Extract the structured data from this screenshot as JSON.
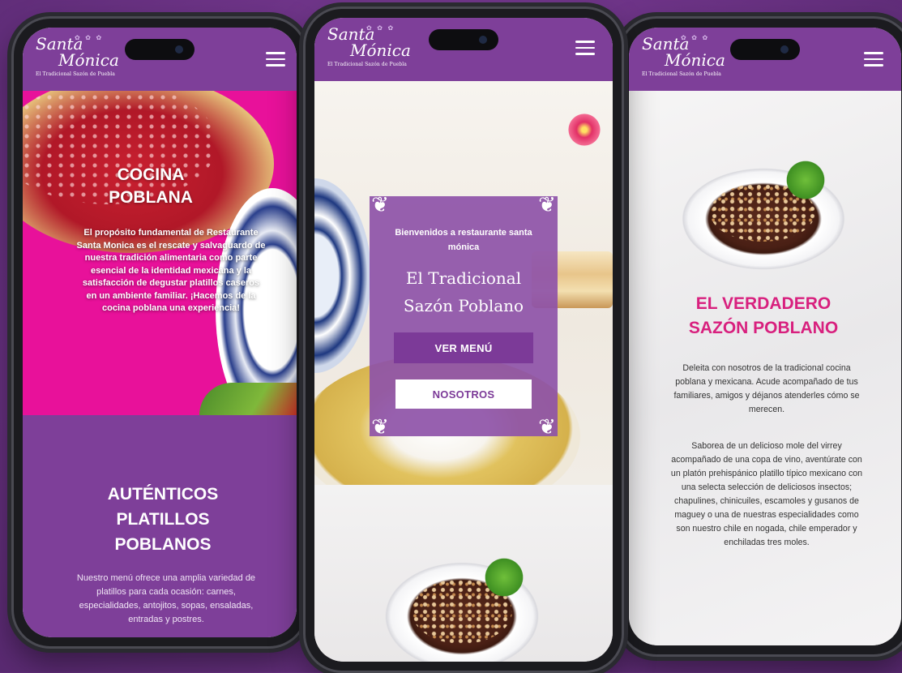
{
  "brand": {
    "logo_line1": "Santa",
    "logo_line2": "Mónica",
    "logo_tagline": "El Tradicional Sazón de Puebla",
    "accent_purple": "#7e3f99",
    "accent_pink": "#d8207e"
  },
  "phone1": {
    "hero_title": "COCINA POBLANA",
    "hero_text": "El propósito fundamental de Restaurante Santa Monica es el rescate y salvaguardo de nuestra tradición alimentaria como parte esencial de la identidad mexicana y la satisfacción de degustar platillos caseros en un ambiente familiar. ¡Hacemos de la cocina poblana una experiencia!",
    "section_title": "AUTÉNTICOS PLATILLOS POBLANOS",
    "section_text": "Nuestro menú ofrece una amplia variedad de platillos para cada ocasión: carnes, especialidades, antojitos, sopas, ensaladas, entradas y postres."
  },
  "phone2": {
    "welcome": "Bienvenidos a restaurante santa mónica",
    "title": "El Tradicional Sazón Poblano",
    "btn_menu": "VER MENÚ",
    "btn_about": "NOSOTROS"
  },
  "phone3": {
    "title": "EL VERDADERO SAZÓN POBLANO",
    "p1": "Deleita con nosotros de la tradicional cocina poblana y mexicana. Acude acompañado de tus familiares, amigos y déjanos atenderles cómo se merecen.",
    "p2": "Saborea de un delicioso mole del virrey acompañado de una copa de vino, aventúrate con un platón prehispánico platillo típico mexicano con una selecta selección de deliciosos insectos; chapulines, chinicuiles, escamoles y gusanos de maguey o una de nuestras especialidades como son nuestro chile en nogada, chile emperador y enchiladas tres moles."
  },
  "icons": {
    "menu": "hamburger-icon",
    "corner": "ornament-corner-icon"
  }
}
